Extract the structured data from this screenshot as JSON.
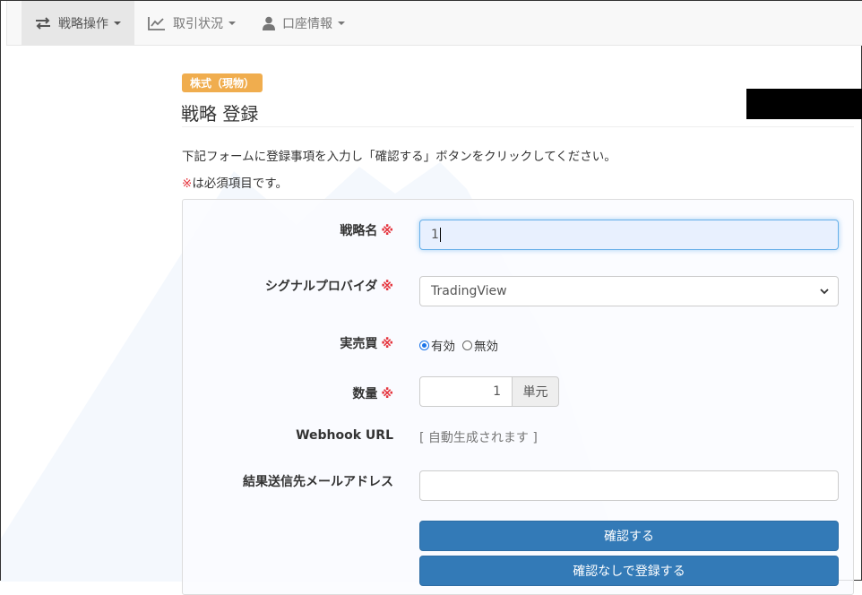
{
  "navbar": {
    "items": [
      {
        "label": "戦略操作",
        "icon": "transfer-arrows-icon",
        "active": true
      },
      {
        "label": "取引状況",
        "icon": "line-chart-icon",
        "active": false
      },
      {
        "label": "口座情報",
        "icon": "user-icon",
        "active": false
      }
    ]
  },
  "header": {
    "badge": "株式（現物）",
    "title": "戦略 登録"
  },
  "intro": {
    "instruction": "下記フォームに登録事項を入力し「確認する」ボタンをクリックしてください。",
    "required_mark": "※",
    "required_text": "は必須項目です。"
  },
  "form": {
    "strategy_name": {
      "label": "戦略名",
      "value": "1"
    },
    "signal_provider": {
      "label": "シグナルプロバイダ",
      "selected": "TradingView"
    },
    "real_trading": {
      "label": "実売買",
      "options": [
        "有効",
        "無効"
      ],
      "selected": "有効"
    },
    "quantity": {
      "label": "数量",
      "value": "1",
      "unit": "単元"
    },
    "webhook": {
      "label": "Webhook URL",
      "value": "[ 自動生成されます ]"
    },
    "email": {
      "label": "結果送信先メールアドレス",
      "value": ""
    },
    "required_mark": "※"
  },
  "buttons": {
    "confirm": "確認する",
    "register_without_confirm": "確認なしで登録する"
  },
  "colors": {
    "primary": "#337ab7",
    "badge": "#f0ad4e",
    "required": "#e5343d",
    "focus": "#66afe9"
  }
}
